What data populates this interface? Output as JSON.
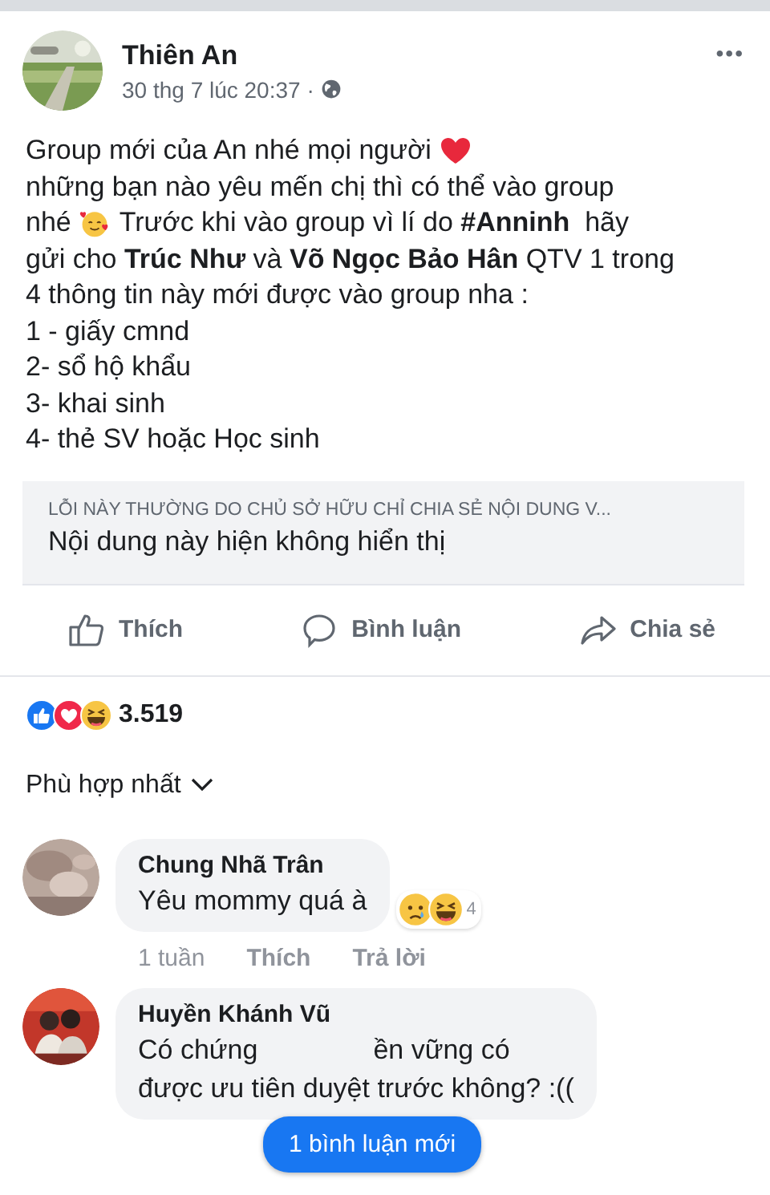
{
  "post": {
    "author": "Thiên An",
    "time": "30 thg 7 lúc 20:37 ·",
    "menu": "•••",
    "lines": [
      {
        "kind": "hearted",
        "text": "Group mới của An nhé mọi người"
      },
      {
        "text": "những bạn nào yêu mến chị thì có thể vào group"
      },
      {
        "kind": "smiling",
        "lead": "nhé",
        "text": "Trước khi vào group vì lí do **#Anninh**  hãy"
      },
      {
        "text": "gửi cho **Trúc Như** và **Võ Ngọc Bảo Hân** QTV 1 trong"
      },
      {
        "text": "4 thông tin này mới được vào group nha :"
      },
      {
        "text": "1 - giấy cmnd"
      },
      {
        "text": "2- sổ hộ khẩu"
      },
      {
        "text": "3- khai sinh"
      },
      {
        "text": "4- thẻ SV hoặc Học sinh"
      }
    ],
    "unavailable": {
      "notice": "LỖI NÀY THƯỜNG DO CHỦ SỞ HỮU CHỈ CHIA SẺ NỘI DUNG V...",
      "message": "Nội dung này hiện không hiển thị"
    },
    "actions": [
      {
        "label": "Thích"
      },
      {
        "label": "Bình luận"
      },
      {
        "label": "Chia sẻ"
      }
    ],
    "reactions": {
      "types": [
        {
          "kind": "like"
        },
        {
          "kind": "love"
        },
        {
          "kind": "haha"
        }
      ],
      "count": "3.519"
    }
  },
  "sort": "Phù hợp nhất",
  "comments": [
    {
      "author": "Chung Nhã Trân",
      "rows": [
        [
          "Yêu mommy quá à"
        ]
      ],
      "reactions": {
        "types": [
          {
            "kind": "sad"
          },
          {
            "kind": "haha"
          }
        ],
        "count": "4"
      },
      "actions": [
        "1 tuần",
        "Thích",
        "Trả lời"
      ]
    },
    {
      "author": "Huyền Khánh Vũ",
      "rows": [
        [
          "Có chứng",
          "ền vững có"
        ],
        [
          "được ưu tiên duyệt trước không? :(("
        ]
      ]
    }
  ],
  "new_comments_pill": "1 bình luận mới"
}
